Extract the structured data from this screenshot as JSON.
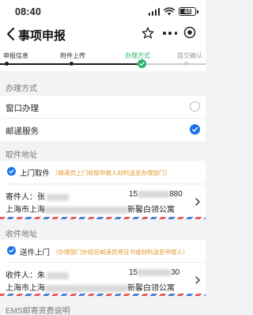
{
  "status_bar": {
    "time": "08:40",
    "battery": "48"
  },
  "nav": {
    "title": "事项申报"
  },
  "steps": [
    {
      "label": "申报信息",
      "state": "done"
    },
    {
      "label": "附件上传",
      "state": "done"
    },
    {
      "label": "办理方式",
      "state": "active"
    },
    {
      "label": "提交确认",
      "state": "pending"
    }
  ],
  "method_section": {
    "title": "办理方式",
    "options": [
      {
        "label": "窗口办理",
        "selected": false
      },
      {
        "label": "邮递服务",
        "selected": true
      }
    ]
  },
  "pickup": {
    "title": "取件地址",
    "method": "上门取件",
    "note": "（邮递员上门收取申报人材料送至办理部门）",
    "sender_label": "寄件人：",
    "sender_name": "张",
    "phone_prefix": "15",
    "phone_suffix": "880",
    "addr_prefix": "上海市上海",
    "addr_suffix": "新馨白领公寓"
  },
  "return": {
    "title": "收件地址",
    "method": "送件上门",
    "note": "（办理部门办结后邮递员将证书或材料送至申报人）",
    "receiver_label": "收件人：",
    "receiver_name": "朱",
    "phone_prefix": "15",
    "phone_suffix": "30",
    "addr_prefix": "上海市上海",
    "addr_suffix": "新馨白领公寓"
  },
  "fee_section": {
    "title": "EMS邮寄资费说明"
  },
  "colors": {
    "accent": "#1a73e8",
    "step_active": "#24b36b",
    "note": "#e39a2d"
  }
}
